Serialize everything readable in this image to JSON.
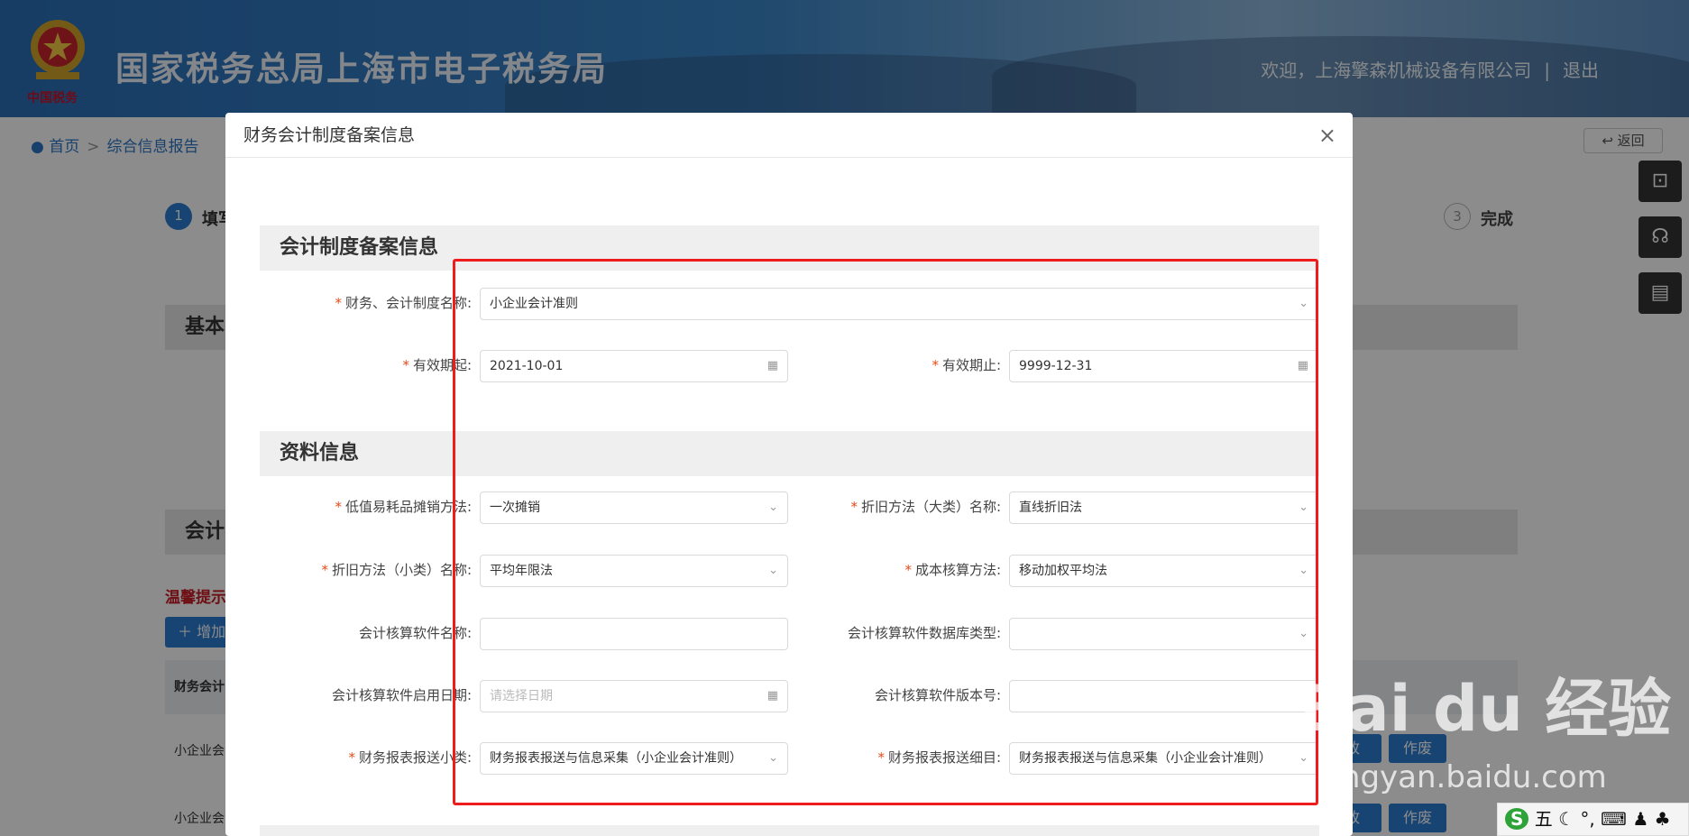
{
  "header": {
    "title": "国家税务总局上海市电子税务局",
    "welcome": "欢迎，上海擎森机械设备有限公司",
    "divider": "|",
    "logout": "退出",
    "seal_text": "中国税务"
  },
  "breadcrumb": {
    "home": "首页",
    "sep": ">",
    "current": "综合信息报告"
  },
  "back_label": "返回",
  "steps": [
    {
      "num": "1",
      "label": "填写"
    },
    {
      "num": "3",
      "label": "完成"
    }
  ],
  "background": {
    "band1": "基本",
    "band2": "会计",
    "tip": "温馨提示",
    "add_btn": "增加",
    "table_head": "财务会计",
    "row1": "小企业会",
    "row2": "小企业会",
    "edit_btn": "改",
    "void_btn": "作废"
  },
  "modal": {
    "title": "财务会计制度备案信息",
    "close": "×",
    "section1": "会计制度备案信息",
    "section2": "资料信息"
  },
  "form": {
    "system_name_label": "财务、会计制度名称:",
    "system_name_value": "小企业会计准则",
    "valid_from_label": "有效期起:",
    "valid_from_value": "2021-10-01",
    "valid_to_label": "有效期止:",
    "valid_to_value": "9999-12-31",
    "low_value_label": "低值易耗品摊销方法:",
    "low_value_value": "一次摊销",
    "dep_major_label": "折旧方法（大类）名称:",
    "dep_major_value": "直线折旧法",
    "dep_minor_label": "折旧方法（小类）名称:",
    "dep_minor_value": "平均年限法",
    "cost_label": "成本核算方法:",
    "cost_value": "移动加权平均法",
    "software_name_label": "会计核算软件名称:",
    "software_name_value": "",
    "db_type_label": "会计核算软件数据库类型:",
    "db_type_value": "",
    "start_date_label": "会计核算软件启用日期:",
    "start_date_placeholder": "请选择日期",
    "version_label": "会计核算软件版本号:",
    "version_value": "",
    "report_sub_label": "财务报表报送小类:",
    "report_sub_value": "财务报表报送与信息采集（小企业会计准则）",
    "report_detail_label": "财务报表报送细目:",
    "report_detail_value": "财务报表报送与信息采集（小企业会计准则）"
  },
  "watermark": {
    "main": "Bai du 经验",
    "sub": "jingyan.baidu.com"
  },
  "ime": {
    "logo": "S",
    "text": "五 ☾ °, ⌨ ♟ ♣ ⋮"
  },
  "colors": {
    "brand_blue": "#2c76c6",
    "required": "#e64a19",
    "highlight": "#ee1c1c"
  }
}
